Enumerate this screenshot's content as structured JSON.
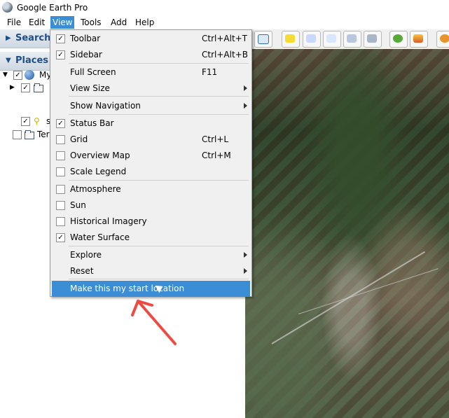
{
  "window": {
    "title": "Google Earth Pro"
  },
  "menu": {
    "file": "File",
    "edit": "Edit",
    "view": "View",
    "tools": "Tools",
    "add": "Add",
    "help": "Help"
  },
  "view_menu": {
    "toolbar": {
      "label": "Toolbar",
      "checked": true,
      "shortcut": "Ctrl+Alt+T"
    },
    "sidebar": {
      "label": "Sidebar",
      "checked": true,
      "shortcut": "Ctrl+Alt+B"
    },
    "full_screen": {
      "label": "Full Screen",
      "shortcut": "F11"
    },
    "view_size": {
      "label": "View Size"
    },
    "show_navigation": {
      "label": "Show Navigation"
    },
    "status_bar": {
      "label": "Status Bar",
      "checked": true
    },
    "grid": {
      "label": "Grid",
      "checked": false,
      "shortcut": "Ctrl+L"
    },
    "overview_map": {
      "label": "Overview Map",
      "checked": false,
      "shortcut": "Ctrl+M"
    },
    "scale_legend": {
      "label": "Scale Legend",
      "checked": false
    },
    "atmosphere": {
      "label": "Atmosphere",
      "checked": false
    },
    "sun": {
      "label": "Sun",
      "checked": false
    },
    "historical_imagery": {
      "label": "Historical Imagery",
      "checked": false
    },
    "water_surface": {
      "label": "Water Surface",
      "checked": true
    },
    "explore": {
      "label": "Explore"
    },
    "reset": {
      "label": "Reset"
    },
    "make_start_location": {
      "label": "Make this my start location"
    }
  },
  "sidebar": {
    "search_label": "Search",
    "places_label": "Places",
    "tree": [
      {
        "label": "My"
      },
      {
        "label": ""
      },
      {
        "label": "s"
      },
      {
        "label": "Ter"
      }
    ]
  },
  "colors": {
    "menu_highlight": "#3b8ed6",
    "annotation_arrow": "#ee4a44",
    "panel_header_text": "#1f4f8a"
  },
  "icons": [
    "google-earth-app-icon",
    "checkmark-icon",
    "submenu-arrow-icon",
    "folder-icon",
    "pushpin-icon",
    "globe-icon",
    "mouse-cursor-icon",
    "red-annotation-arrow-icon"
  ]
}
